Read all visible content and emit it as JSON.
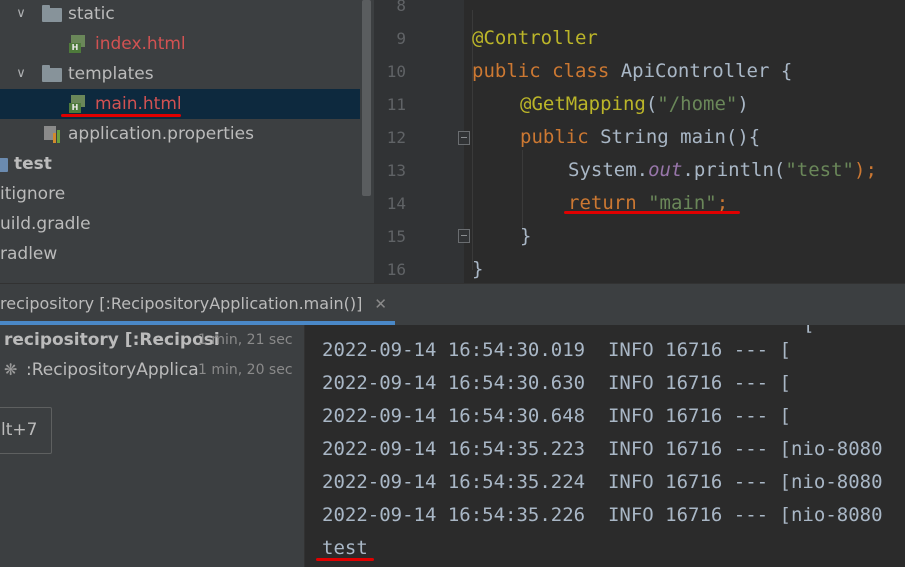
{
  "project_tree": {
    "items": [
      {
        "label": "static"
      },
      {
        "label": "index.html"
      },
      {
        "label": "templates"
      },
      {
        "label": "main.html"
      },
      {
        "label": "application.properties"
      },
      {
        "label": "test"
      },
      {
        "label": "itignore"
      },
      {
        "label": "uild.gradle"
      },
      {
        "label": "radlew"
      }
    ]
  },
  "editor": {
    "line_numbers": [
      "8",
      "9",
      "10",
      "11",
      "12",
      "13",
      "14",
      "15",
      "16"
    ],
    "code": {
      "l9_anno": "@Controller",
      "l10_kw": "public class ",
      "l10_rest": "ApiController {",
      "l11_anno": "@GetMapping",
      "l11_p1": "(",
      "l11_str": "\"/home\"",
      "l11_p2": ")",
      "l12_kw": "public ",
      "l12_rest": "String main(){",
      "l13_a": "System.",
      "l13_field": "out",
      "l13_b": ".println(",
      "l13_str": "\"test\"",
      "l13_c": ");",
      "l14_kw": "return ",
      "l14_str": "\"main\"",
      "l14_semi": ";",
      "l15": "}",
      "l16": "}"
    }
  },
  "run_bar": {
    "tab_label": "recipository [:RecipositoryApplication.main()]",
    "close_glyph": "✕"
  },
  "run_tree": {
    "items": [
      {
        "label": "recipository [:Reciposi",
        "time": "1 min, 21 sec"
      },
      {
        "label": ":RecipositoryApplica",
        "time": "1 min, 20 sec"
      }
    ],
    "tooltip": "lt+7"
  },
  "console": {
    "lines": [
      "2022-09-14 16:54:30.019  INFO 16716 --- [",
      "2022-09-14 16:54:30.630  INFO 16716 --- [",
      "2022-09-14 16:54:30.648  INFO 16716 --- [",
      "2022-09-14 16:54:35.223  INFO 16716 --- [nio-8080",
      "2022-09-14 16:54:35.224  INFO 16716 --- [nio-8080",
      "2022-09-14 16:54:35.226  INFO 16716 --- [nio-8080",
      "test"
    ],
    "partial_top": "["
  },
  "colors": {
    "annotation": "#bbb529",
    "keyword": "#cc7832",
    "string": "#6a8759",
    "highlight_underline": "#e00000",
    "selection": "#0d293e"
  }
}
